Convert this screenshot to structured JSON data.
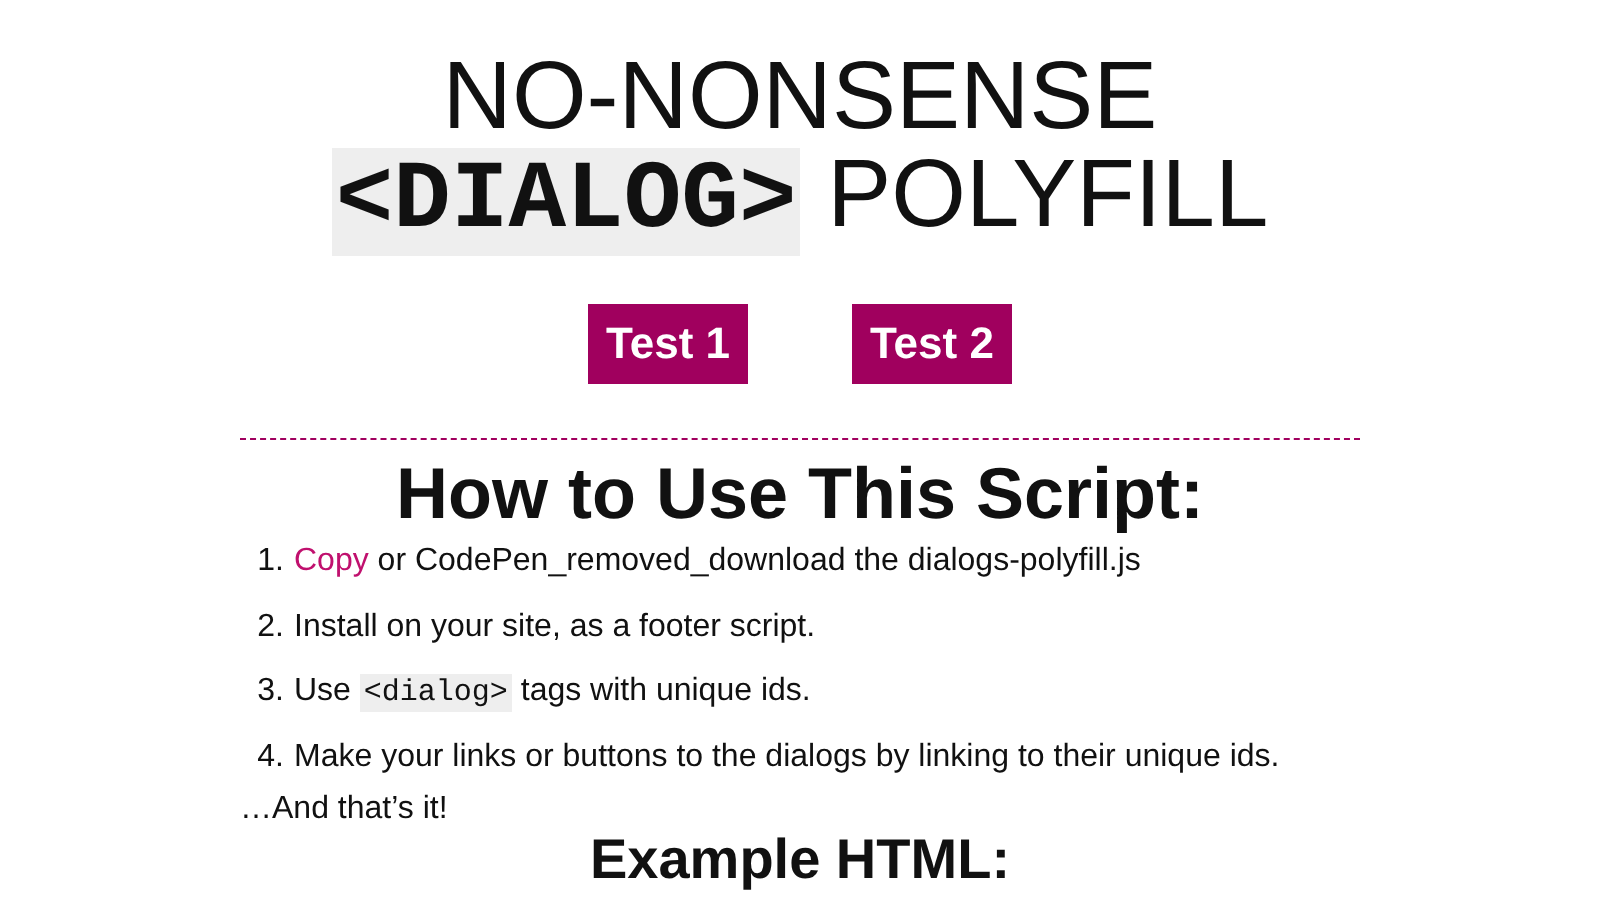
{
  "title": {
    "code": "<DIALOG>",
    "line1": "NO-NONSENSE",
    "rest": "POLYFILL"
  },
  "buttons": [
    "Test 1",
    "Test 2"
  ],
  "section": {
    "heading": "How to Use This Script:",
    "steps": [
      {
        "number": "1.",
        "parts": [
          {
            "kind": "link",
            "text": "Copy"
          },
          {
            "kind": "text",
            "text": " or CodePen_removed_download the dialogs-polyfill.js"
          }
        ]
      },
      {
        "number": "2.",
        "parts": [
          {
            "kind": "text",
            "text": "Install on your site, as a footer script."
          }
        ]
      },
      {
        "number": "3.",
        "parts": [
          {
            "kind": "text",
            "text": "Use "
          },
          {
            "kind": "code",
            "text": "<dialog>"
          },
          {
            "kind": "text",
            "text": " tags with unique ids."
          }
        ]
      },
      {
        "number": "4.",
        "parts": [
          {
            "kind": "text",
            "text": "Make your links or buttons to the dialogs by linking to their unique ids."
          }
        ]
      }
    ],
    "closing": "…And that’s it!"
  },
  "next_heading": "Example HTML:"
}
